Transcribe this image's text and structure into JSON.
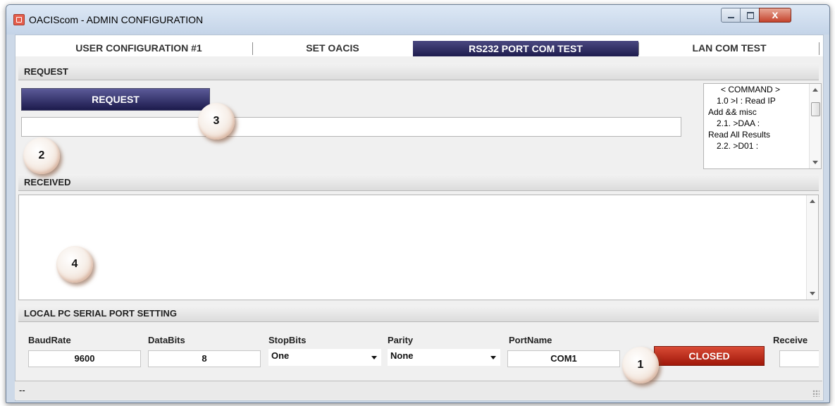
{
  "window": {
    "title": "OACIScom - ADMIN CONFIGURATION",
    "close_label": "x"
  },
  "tabs": [
    {
      "label": "USER CONFIGURATION #1",
      "active": false
    },
    {
      "label": "SET OACIS",
      "active": false
    },
    {
      "label": "RS232 PORT COM TEST",
      "active": true
    },
    {
      "label": "LAN COM TEST",
      "active": false
    }
  ],
  "request": {
    "header": "REQUEST",
    "button_label": "REQUEST",
    "input_value": "",
    "commands": [
      "< COMMAND >",
      "1.0  >I :  Read IP",
      "Add && misc",
      "2.1.  >DAA :",
      "Read All Results",
      "2.2.  >D01  :"
    ]
  },
  "received": {
    "header": "RECEIVED",
    "value": ""
  },
  "serial": {
    "header": "LOCAL PC SERIAL PORT SETTING",
    "baudrate_label": "BaudRate",
    "baudrate_value": "9600",
    "databits_label": "DataBits",
    "databits_value": "8",
    "stopbits_label": "StopBits",
    "stopbits_value": "One",
    "parity_label": "Parity",
    "parity_value": "None",
    "portname_label": "PortName",
    "portname_value": "COM1",
    "status_button": "CLOSED",
    "receive_label": "Receive"
  },
  "status_bar": {
    "text": "--"
  },
  "callouts": [
    "1",
    "2",
    "3",
    "4"
  ],
  "colors": {
    "active_tab": "#1e1c4e",
    "closed_button": "#c42a17"
  }
}
